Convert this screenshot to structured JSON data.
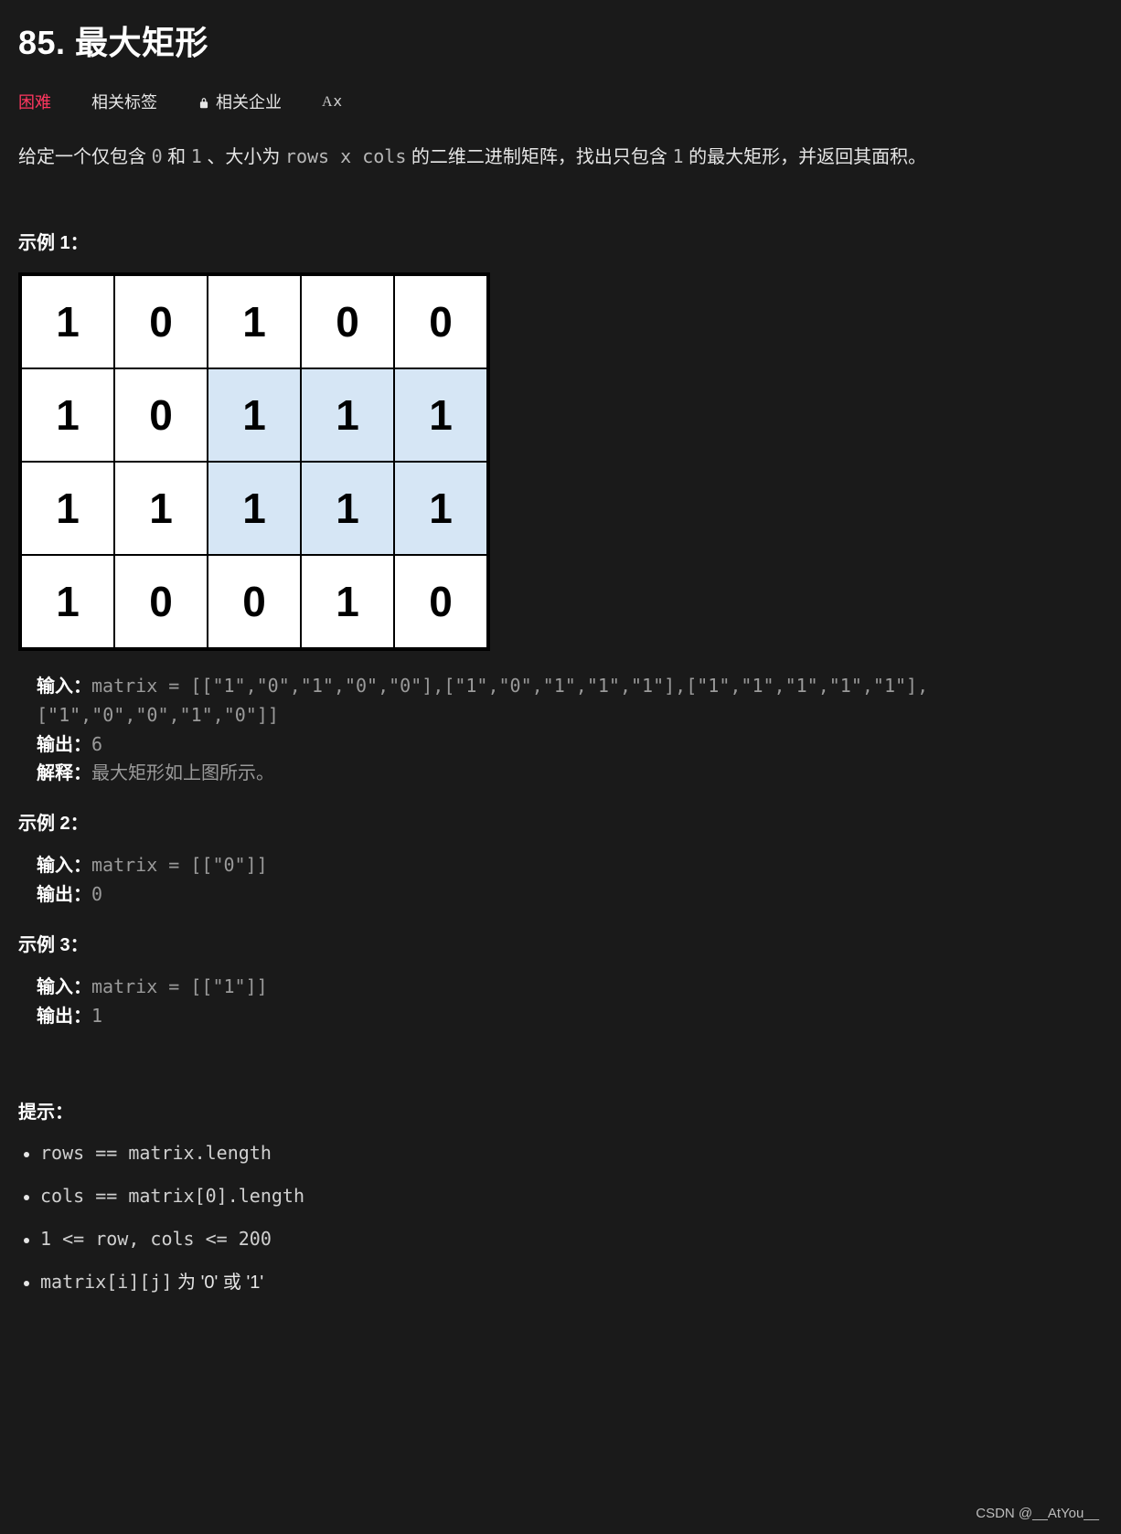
{
  "title": "85. 最大矩形",
  "meta": {
    "difficulty": "困难",
    "related_tags": "相关标签",
    "related_companies": "相关企业",
    "font_switch": "A𝗑"
  },
  "description": {
    "p1": "给定一个仅包含 ",
    "c1": "0",
    "p2": " 和 ",
    "c2": "1",
    "p3": " 、大小为 ",
    "c3": "rows x cols",
    "p4": " 的二维二进制矩阵，找出只包含 ",
    "c4": "1",
    "p5": " 的最大矩形，并返回其面积。"
  },
  "example1": {
    "heading": "示例 1：",
    "matrix": [
      [
        {
          "v": "1",
          "hl": false
        },
        {
          "v": "0",
          "hl": false
        },
        {
          "v": "1",
          "hl": false
        },
        {
          "v": "0",
          "hl": false
        },
        {
          "v": "0",
          "hl": false
        }
      ],
      [
        {
          "v": "1",
          "hl": false
        },
        {
          "v": "0",
          "hl": false
        },
        {
          "v": "1",
          "hl": true
        },
        {
          "v": "1",
          "hl": true
        },
        {
          "v": "1",
          "hl": true
        }
      ],
      [
        {
          "v": "1",
          "hl": false
        },
        {
          "v": "1",
          "hl": false
        },
        {
          "v": "1",
          "hl": true
        },
        {
          "v": "1",
          "hl": true
        },
        {
          "v": "1",
          "hl": true
        }
      ],
      [
        {
          "v": "1",
          "hl": false
        },
        {
          "v": "0",
          "hl": false
        },
        {
          "v": "0",
          "hl": false
        },
        {
          "v": "1",
          "hl": false
        },
        {
          "v": "0",
          "hl": false
        }
      ]
    ],
    "input_label": "输入：",
    "input_value": "matrix = [[\"1\",\"0\",\"1\",\"0\",\"0\"],[\"1\",\"0\",\"1\",\"1\",\"1\"],[\"1\",\"1\",\"1\",\"1\",\"1\"],[\"1\",\"0\",\"0\",\"1\",\"0\"]]",
    "output_label": "输出：",
    "output_value": "6",
    "explain_label": "解释：",
    "explain_value": "最大矩形如上图所示。"
  },
  "example2": {
    "heading": "示例 2：",
    "input_label": "输入：",
    "input_value": "matrix = [[\"0\"]]",
    "output_label": "输出：",
    "output_value": "0"
  },
  "example3": {
    "heading": "示例 3：",
    "input_label": "输入：",
    "input_value": "matrix = [[\"1\"]]",
    "output_label": "输出：",
    "output_value": "1"
  },
  "hints": {
    "heading": "提示：",
    "items": [
      {
        "mono": "rows == matrix.length"
      },
      {
        "mono": "cols == matrix[0].length"
      },
      {
        "mono": "1 <= row, cols <= 200"
      },
      {
        "mono": "matrix[i][j]",
        "tail": " 为 '0' 或 '1'"
      }
    ]
  },
  "watermark": "CSDN @__AtYou__"
}
